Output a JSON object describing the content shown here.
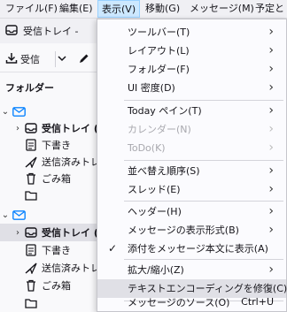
{
  "menubar": {
    "items": [
      {
        "label": "ファイル(F)"
      },
      {
        "label": "編集(E)"
      },
      {
        "label": "表示(V)"
      },
      {
        "label": "移動(G)"
      },
      {
        "label": "メッセージ(M)"
      },
      {
        "label": "予定と"
      }
    ]
  },
  "tab": {
    "label": "受信トレイ -"
  },
  "toolbar": {
    "receive_label": "受信"
  },
  "folders": {
    "title": "フォルダー",
    "rows": [
      {
        "label": "受信トレイ ("
      },
      {
        "label": "下書き"
      },
      {
        "label": "送信済みトレ"
      },
      {
        "label": "ごみ箱"
      },
      {
        "label": ""
      },
      {
        "label": "受信トレイ ("
      },
      {
        "label": "下書き"
      },
      {
        "label": "送信済みトレ"
      },
      {
        "label": "ごみ箱"
      },
      {
        "label": ""
      }
    ]
  },
  "view_menu": {
    "items": [
      {
        "label": "ツールバー(T)"
      },
      {
        "label": "レイアウト(L)"
      },
      {
        "label": "フォルダー(F)"
      },
      {
        "label": "UI 密度(D)"
      },
      {
        "label": "Today ペイン(T)"
      },
      {
        "label": "カレンダー(N)"
      },
      {
        "label": "ToDo(K)"
      },
      {
        "label": "並べ替え順序(S)"
      },
      {
        "label": "スレッド(E)"
      },
      {
        "label": "ヘッダー(H)"
      },
      {
        "label": "メッセージの表示形式(B)"
      },
      {
        "label": "添付をメッセージ本文に表示(A)"
      },
      {
        "label": "拡大/縮小(Z)"
      },
      {
        "label": "テキストエンコーディングを修復(C)"
      },
      {
        "label": "メッセージのソース(O)",
        "shortcut": "Ctrl+U"
      }
    ]
  }
}
